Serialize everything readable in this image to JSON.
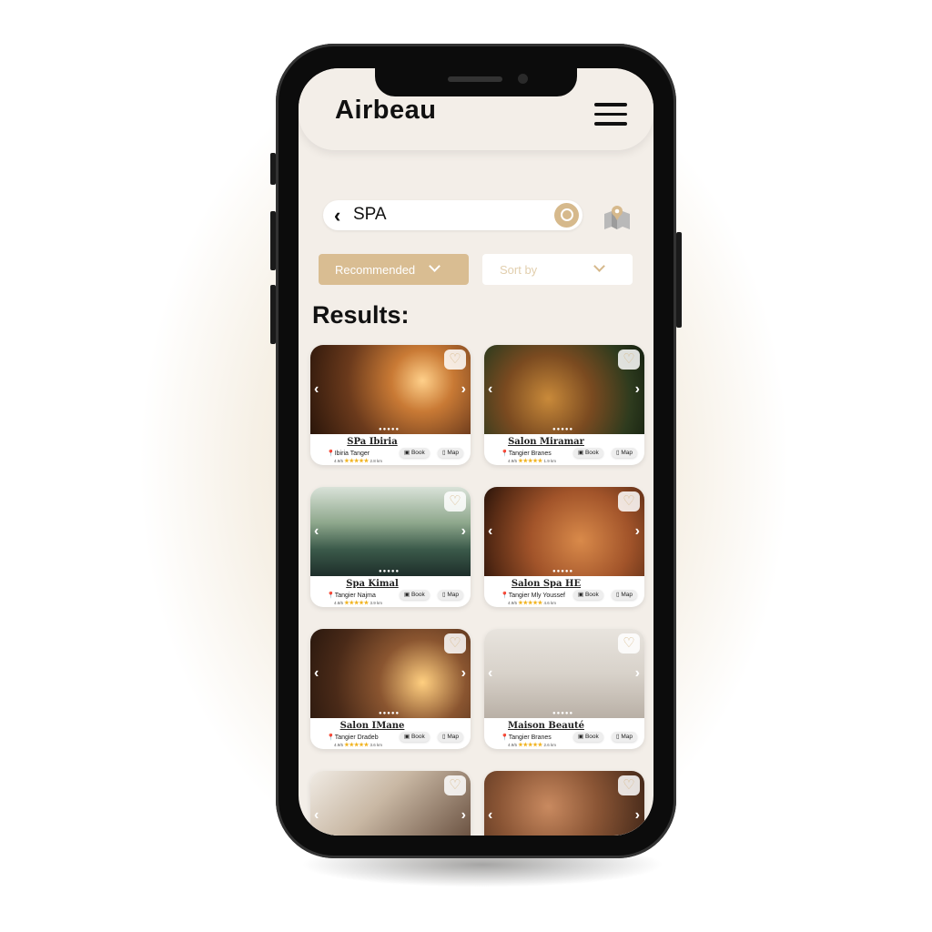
{
  "app": {
    "title": "Airbeau"
  },
  "search": {
    "query": "SPA",
    "back_icon": "chevron-left-icon",
    "search_icon": "search-icon",
    "map_icon": "map-pin-icon"
  },
  "filters": {
    "recommended": "Recommended",
    "sort_by": "Sort by"
  },
  "results_heading": "Results:",
  "colors": {
    "accent": "#d9bd92",
    "background": "#f3eee8"
  },
  "cards": [
    {
      "name": "SPa Ibiria",
      "location": "Ibiria Tanger",
      "rating": "4.9/5",
      "distance": "2.8 km",
      "book": "Book",
      "map": "Map"
    },
    {
      "name": "Salon Miramar",
      "location": "Tangier Branes",
      "rating": "4.9/5",
      "distance": "1.9 km",
      "book": "Book",
      "map": "Map"
    },
    {
      "name": "Spa Kimal",
      "location": "Tangier Najma",
      "rating": "4.8/5",
      "distance": "3.9 km",
      "book": "Book",
      "map": "Map"
    },
    {
      "name": "Salon Spa HE",
      "location": "Tangier Mly Youssef",
      "rating": "4.9/5",
      "distance": "4.6 km",
      "book": "Book",
      "map": "Map"
    },
    {
      "name": "Salon IMane",
      "location": "Tangier Dradeb",
      "rating": "4.9/5",
      "distance": "3.6 km",
      "book": "Book",
      "map": "Map"
    },
    {
      "name": "Maison Beauté",
      "location": "Tangier Branes",
      "rating": "4.9/5",
      "distance": "2.6 km",
      "book": "Book",
      "map": "Map"
    },
    {
      "name": "",
      "location": "",
      "rating": "",
      "distance": "",
      "book": "",
      "map": ""
    },
    {
      "name": "",
      "location": "",
      "rating": "",
      "distance": "",
      "book": "",
      "map": ""
    }
  ]
}
